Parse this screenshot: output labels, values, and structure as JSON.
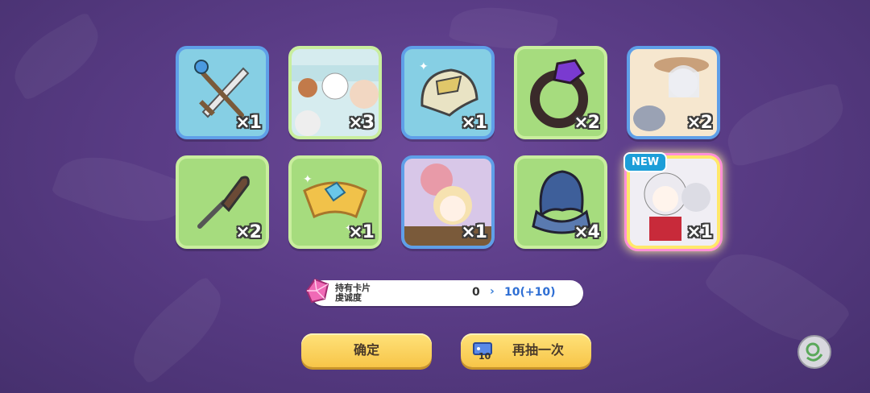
{
  "items": [
    {
      "name": "sword",
      "qty": "×1",
      "frame": "blue"
    },
    {
      "name": "card-scene-1",
      "qty": "×3",
      "frame": "green"
    },
    {
      "name": "helmet",
      "qty": "×1",
      "frame": "blue"
    },
    {
      "name": "ring",
      "qty": "×2",
      "frame": "green"
    },
    {
      "name": "card-scene-2",
      "qty": "×2",
      "frame": "blue"
    },
    {
      "name": "chisel",
      "qty": "×2",
      "frame": "green"
    },
    {
      "name": "tiara",
      "qty": "×1",
      "frame": "green"
    },
    {
      "name": "card-scene-3",
      "qty": "×1",
      "frame": "blue"
    },
    {
      "name": "hood",
      "qty": "×4",
      "frame": "green"
    },
    {
      "name": "card-scene-4",
      "qty": "×1",
      "frame": "rainbow",
      "badge": "NEW"
    }
  ],
  "stat": {
    "label_line1": "持有卡片",
    "label_line2": "虔诚度",
    "from": "0",
    "arrow": "›",
    "to": "10(+10)"
  },
  "buttons": {
    "confirm": "确定",
    "redraw": "再抽一次",
    "ticket_count": "10"
  },
  "colors": {
    "accent_yellow": "#f7c548",
    "frame_green": "#a6dc7e",
    "frame_blue": "#5f9fe8",
    "badge_blue": "#1d9ed8"
  }
}
